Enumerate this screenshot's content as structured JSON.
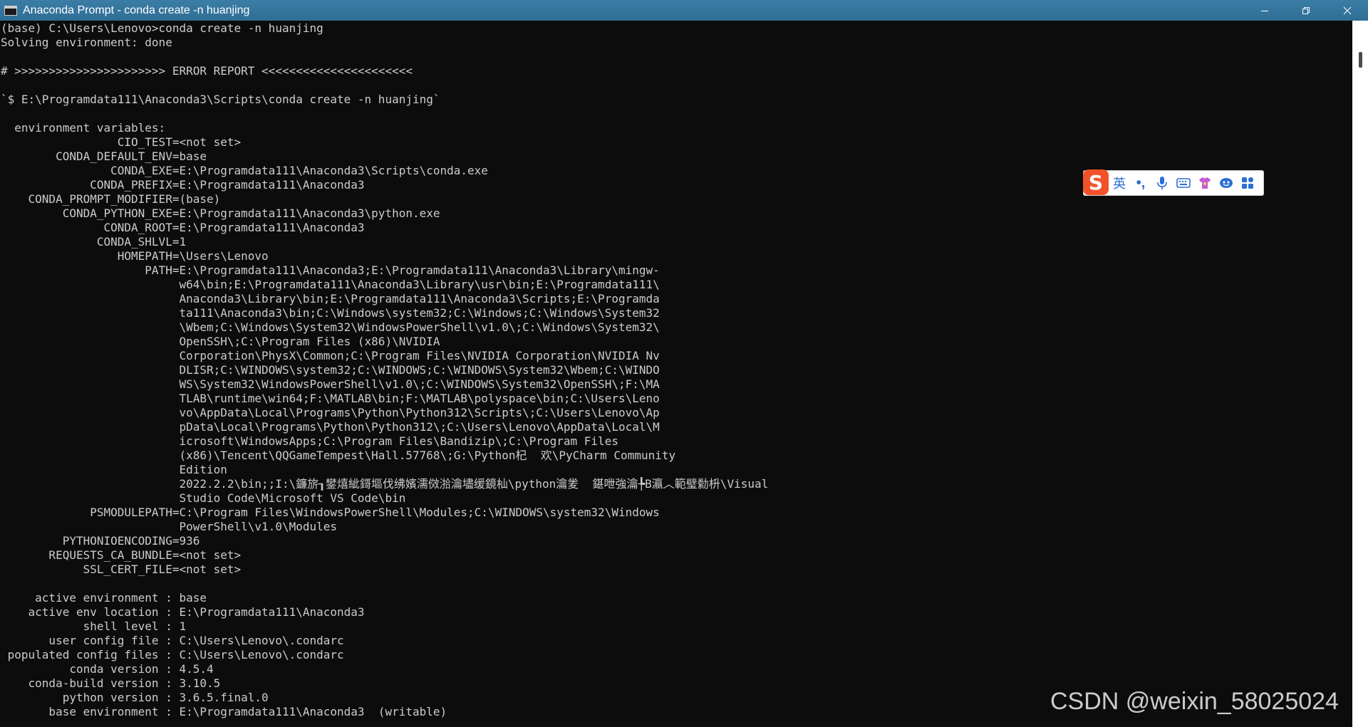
{
  "window": {
    "title": "Anaconda Prompt - conda  create -n huanjing"
  },
  "console": {
    "lines": [
      "(base) C:\\Users\\Lenovo>conda create -n huanjing",
      "Solving environment: done",
      "",
      "# >>>>>>>>>>>>>>>>>>>>>> ERROR REPORT <<<<<<<<<<<<<<<<<<<<<<",
      "",
      "`$ E:\\Programdata111\\Anaconda3\\Scripts\\conda create -n huanjing`",
      "",
      "  environment variables:",
      "                 CIO_TEST=<not set>",
      "        CONDA_DEFAULT_ENV=base",
      "                CONDA_EXE=E:\\Programdata111\\Anaconda3\\Scripts\\conda.exe",
      "             CONDA_PREFIX=E:\\Programdata111\\Anaconda3",
      "    CONDA_PROMPT_MODIFIER=(base)",
      "         CONDA_PYTHON_EXE=E:\\Programdata111\\Anaconda3\\python.exe",
      "               CONDA_ROOT=E:\\Programdata111\\Anaconda3",
      "              CONDA_SHLVL=1",
      "                 HOMEPATH=\\Users\\Lenovo",
      "                     PATH=E:\\Programdata111\\Anaconda3;E:\\Programdata111\\Anaconda3\\Library\\mingw-",
      "                          w64\\bin;E:\\Programdata111\\Anaconda3\\Library\\usr\\bin;E:\\Programdata111\\",
      "                          Anaconda3\\Library\\bin;E:\\Programdata111\\Anaconda3\\Scripts;E:\\Programda",
      "                          ta111\\Anaconda3\\bin;C:\\Windows\\system32;C:\\Windows;C:\\Windows\\System32",
      "                          \\Wbem;C:\\Windows\\System32\\WindowsPowerShell\\v1.0\\;C:\\Windows\\System32\\",
      "                          OpenSSH\\;C:\\Program Files (x86)\\NVIDIA",
      "                          Corporation\\PhysX\\Common;C:\\Program Files\\NVIDIA Corporation\\NVIDIA Nv",
      "                          DLISR;C:\\WINDOWS\\system32;C:\\WINDOWS;C:\\WINDOWS\\System32\\Wbem;C:\\WINDO",
      "                          WS\\System32\\WindowsPowerShell\\v1.0\\;C:\\WINDOWS\\System32\\OpenSSH\\;F:\\MA",
      "                          TLAB\\runtime\\win64;F:\\MATLAB\\bin;F:\\MATLAB\\polyspace\\bin;C:\\Users\\Leno",
      "                          vo\\AppData\\Local\\Programs\\Python\\Python312\\Scripts\\;C:\\Users\\Lenovo\\Ap",
      "                          pData\\Local\\Programs\\Python\\Python312\\;C:\\Users\\Lenovo\\AppData\\Local\\M",
      "                          icrosoft\\WindowsApps;C:\\Program Files\\Bandizip\\;C:\\Program Files",
      "                          (x86)\\Tencent\\QQGameTempest\\Hall.57768\\;G:\\Python杞  欢\\PyCharm Community",
      "                          Edition",
      "                          2022.2.2\\bin;;I:\\鐮旂┒鐢熺紪鎶塸伐绋嬪濡傚湁瀹壗缓鏡杣\\python瀹夎  鍖呭強瀹╄В瀛︿範璧勬枡\\Visual",
      "                          Studio Code\\Microsoft VS Code\\bin",
      "             PSMODULEPATH=C:\\Program Files\\WindowsPowerShell\\Modules;C:\\WINDOWS\\system32\\Windows",
      "                          PowerShell\\v1.0\\Modules",
      "         PYTHONIOENCODING=936",
      "       REQUESTS_CA_BUNDLE=<not set>",
      "            SSL_CERT_FILE=<not set>",
      "",
      "     active environment : base",
      "    active env location : E:\\Programdata111\\Anaconda3",
      "            shell level : 1",
      "       user config file : C:\\Users\\Lenovo\\.condarc",
      " populated config files : C:\\Users\\Lenovo\\.condarc",
      "          conda version : 4.5.4",
      "    conda-build version : 3.10.5",
      "         python version : 3.6.5.final.0",
      "       base environment : E:\\Programdata111\\Anaconda3  (writable)"
    ]
  },
  "ime_toolbar": {
    "logo": "S",
    "language": "英",
    "punctuation": "•,",
    "icons": [
      "microphone-icon",
      "keyboard-icon",
      "skin-icon",
      "emoji-icon",
      "grid-icon"
    ],
    "brand_color": "#f2522b",
    "accent_color": "#2a6fd6"
  },
  "watermark": {
    "text": "CSDN @weixin_58025024"
  },
  "colors": {
    "console_bg": "#0c0c0c",
    "console_fg": "#cccccc",
    "titlebar_bg": "#2f6e95"
  }
}
